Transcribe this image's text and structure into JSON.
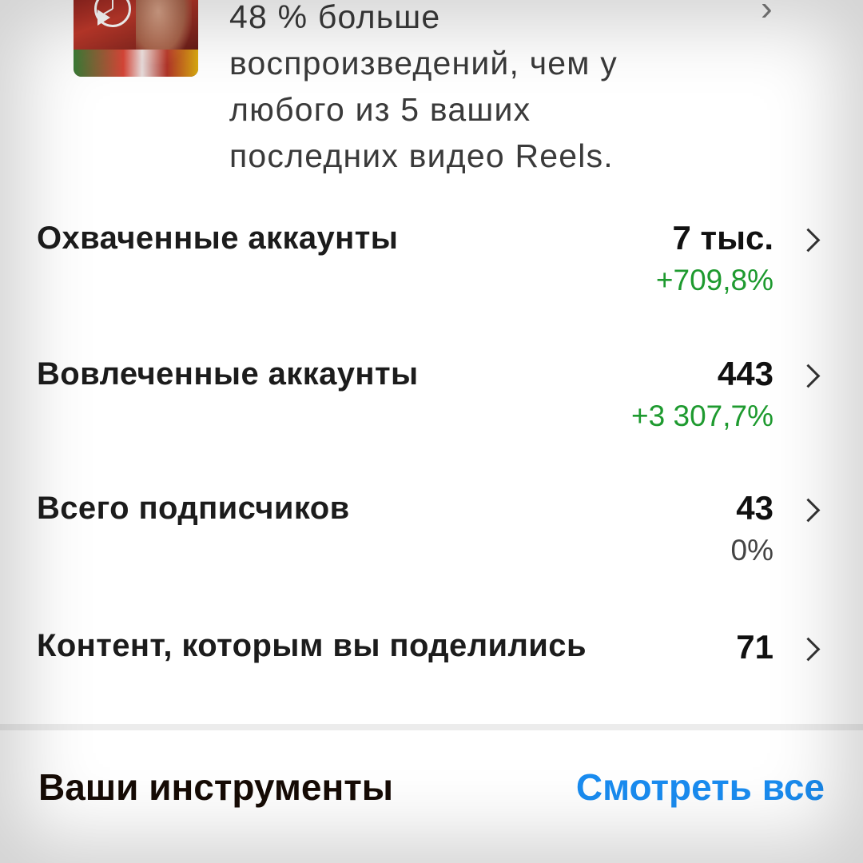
{
  "reel_insight": {
    "text": "48 % больше\nвоспроизведений, чем у\nлюбого из 5 ваших\nпоследних видео Reels."
  },
  "metrics": [
    {
      "label": "Охваченные аккаунты",
      "value": "7 тыс.",
      "change": "+709,8%"
    },
    {
      "label": "Вовлеченные аккаунты",
      "value": "443",
      "change": "+3 307,7%"
    },
    {
      "label": "Всего подписчиков",
      "value": "43",
      "change": "0%"
    },
    {
      "label": "Контент, которым вы поделились",
      "value": "71"
    }
  ],
  "tools": {
    "title": "Ваши инструменты",
    "see_all_label": "Смотреть все"
  },
  "colors": {
    "positive": "#1e9a2f",
    "link": "#1a8cf0"
  },
  "icons": {
    "row_chevron": "chevron-right-icon"
  }
}
